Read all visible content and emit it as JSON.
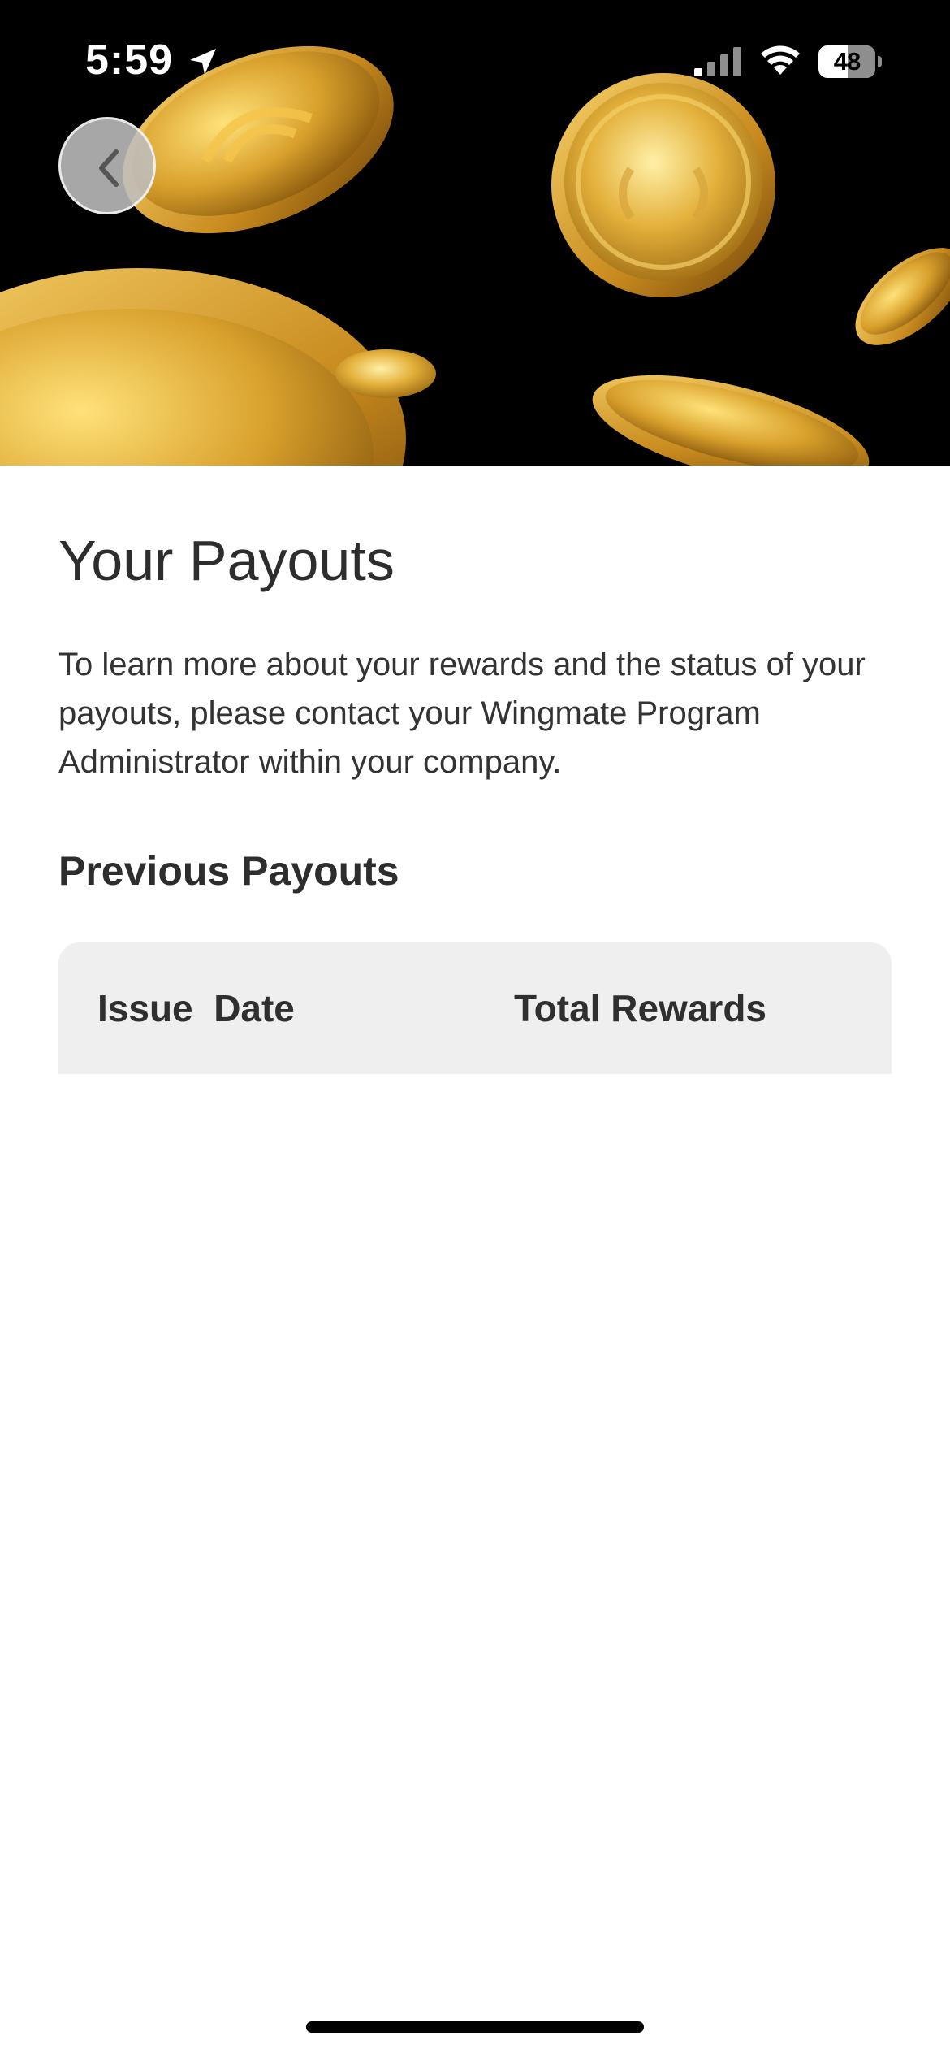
{
  "status_bar": {
    "time": "5:59",
    "battery_level": "48",
    "icons": [
      "location-arrow-icon",
      "cellular-signal-icon",
      "wifi-icon",
      "battery-icon"
    ]
  },
  "hero": {
    "image": "gold-coins-banner",
    "colors": {
      "background": "#000000",
      "gold": "#e0a93a"
    }
  },
  "navigation": {
    "back_icon": "chevron-left-icon"
  },
  "page": {
    "title": "Your Payouts",
    "description": "To learn more about your rewards and the status of your payouts, please contact your Wingmate Program Administrator within your company.",
    "section_title": "Previous Payouts"
  },
  "table": {
    "columns": [
      "Issue  Date",
      "Total Rewards"
    ],
    "rows": []
  }
}
